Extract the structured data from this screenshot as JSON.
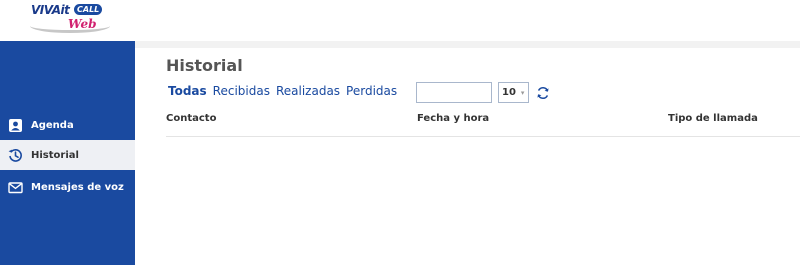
{
  "brand": {
    "name_part1": "VIVAit",
    "name_part2": "CALL",
    "name_part3": "Web"
  },
  "sidebar": {
    "items": [
      {
        "label": "Agenda",
        "icon": "contact-card-icon",
        "active": false
      },
      {
        "label": "Historial",
        "icon": "history-icon",
        "active": true
      },
      {
        "label": "Mensajes de voz",
        "icon": "envelope-icon",
        "active": false
      }
    ]
  },
  "main": {
    "title": "Historial",
    "tabs": [
      {
        "label": "Todas",
        "active": true
      },
      {
        "label": "Recibidas",
        "active": false
      },
      {
        "label": "Realizadas",
        "active": false
      },
      {
        "label": "Perdidas",
        "active": false
      }
    ],
    "search": {
      "value": "",
      "placeholder": ""
    },
    "page_size": "10",
    "columns": [
      "Contacto",
      "Fecha y hora",
      "Tipo de llamada"
    ]
  },
  "colors": {
    "accent": "#1a4aa0",
    "brand_pink": "#d1206f",
    "active_bg": "#eef0f4"
  }
}
